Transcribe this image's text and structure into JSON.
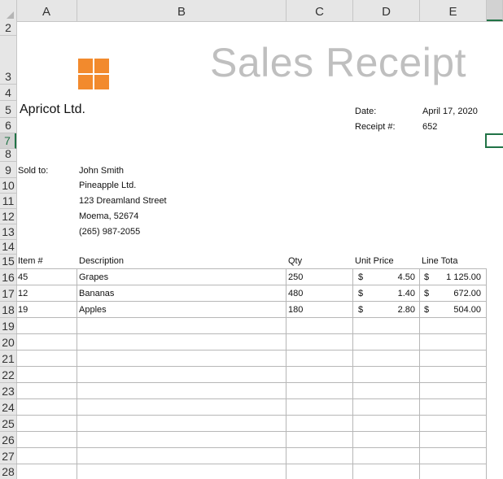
{
  "columns": [
    "A",
    "B",
    "C",
    "D",
    "E"
  ],
  "rows": [
    "2",
    "3",
    "4",
    "5",
    "6",
    "7",
    "8",
    "9",
    "10",
    "11",
    "12",
    "13",
    "14",
    "15",
    "16",
    "17",
    "18",
    "19",
    "20",
    "21",
    "22",
    "23",
    "24",
    "25",
    "26",
    "27",
    "28"
  ],
  "receipt": {
    "title": "Sales Receipt",
    "company": "Apricot Ltd.",
    "date_label": "Date:",
    "date_value": "April 17, 2020",
    "receipt_label": "Receipt #:",
    "receipt_value": "652",
    "sold_to_label": "Sold to:",
    "sold_to": [
      "John Smith",
      "Pineapple Ltd.",
      "123 Dreamland Street",
      "Moema, 52674",
      "(265) 987-2055"
    ]
  },
  "table": {
    "headers": [
      "Item #",
      "Description",
      "Qty",
      "Unit Price",
      "Line Tota"
    ],
    "currency": "$",
    "items": [
      {
        "item": "45",
        "desc": "Grapes",
        "qty": "250",
        "price": "4.50",
        "total": "1 125.00"
      },
      {
        "item": "12",
        "desc": "Bananas",
        "qty": "480",
        "price": "1.40",
        "total": "672.00"
      },
      {
        "item": "19",
        "desc": "Apples",
        "qty": "180",
        "price": "2.80",
        "total": "504.00"
      }
    ]
  },
  "colors": {
    "accent": "#217346",
    "logo": "#f28a2d",
    "title": "#bfbfbf"
  }
}
